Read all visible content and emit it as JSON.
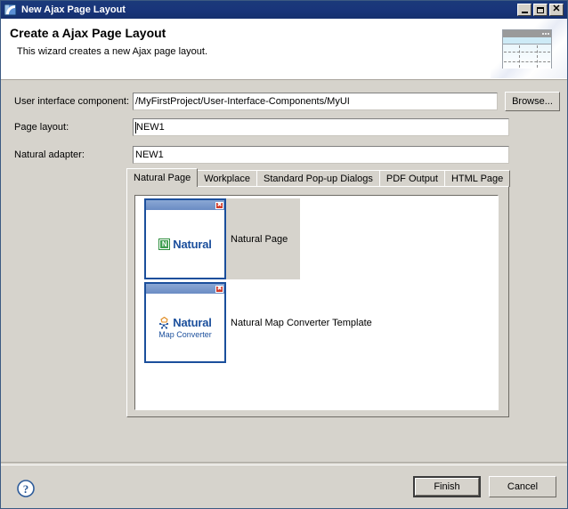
{
  "window": {
    "title": "New Ajax Page Layout",
    "icon": "page-layout-icon",
    "minimize_label": "",
    "maximize_label": "",
    "close_label": "✕"
  },
  "header": {
    "title": "Create a Ajax Page Layout",
    "subtitle": "This wizard creates a new Ajax page layout.",
    "banner_icon": "page-layout-banner-icon"
  },
  "fields": [
    {
      "label": "User interface component:",
      "value": "/MyFirstProject/User-Interface-Components/MyUI",
      "name": "user-interface-component"
    },
    {
      "label": "Page layout:",
      "value": "NEW1",
      "name": "page-layout"
    },
    {
      "label": "Natural adapter:",
      "value": "NEW1",
      "name": "natural-adapter"
    }
  ],
  "browse_button": "Browse...",
  "tabs": [
    {
      "label": "Natural Page",
      "active": true
    },
    {
      "label": "Workplace",
      "active": false
    },
    {
      "label": "Standard Pop-up Dialogs",
      "active": false
    },
    {
      "label": "PDF Output",
      "active": false
    },
    {
      "label": "HTML Page",
      "active": false
    }
  ],
  "templates": [
    {
      "label": "Natural Page",
      "selected": true,
      "logo_word": "Natural",
      "logo_sub": "",
      "logo_mark": "natural-n-icon",
      "close_glyph": "✖"
    },
    {
      "label": "Natural Map Converter Template",
      "selected": false,
      "logo_word": "Natural",
      "logo_sub": "Map Converter",
      "logo_mark": "natural-map-converter-icon",
      "close_glyph": "✖"
    }
  ],
  "footer": {
    "help_icon": "help-question-icon",
    "finish_label": "Finish",
    "cancel_label": "Cancel"
  },
  "colors": {
    "titlebar": "#19357a",
    "dialog_bg": "#d6d3cc",
    "accent_blue": "#1b4f9c",
    "logo_green": "#3f9f4f",
    "selection": "#d6d3cc"
  }
}
